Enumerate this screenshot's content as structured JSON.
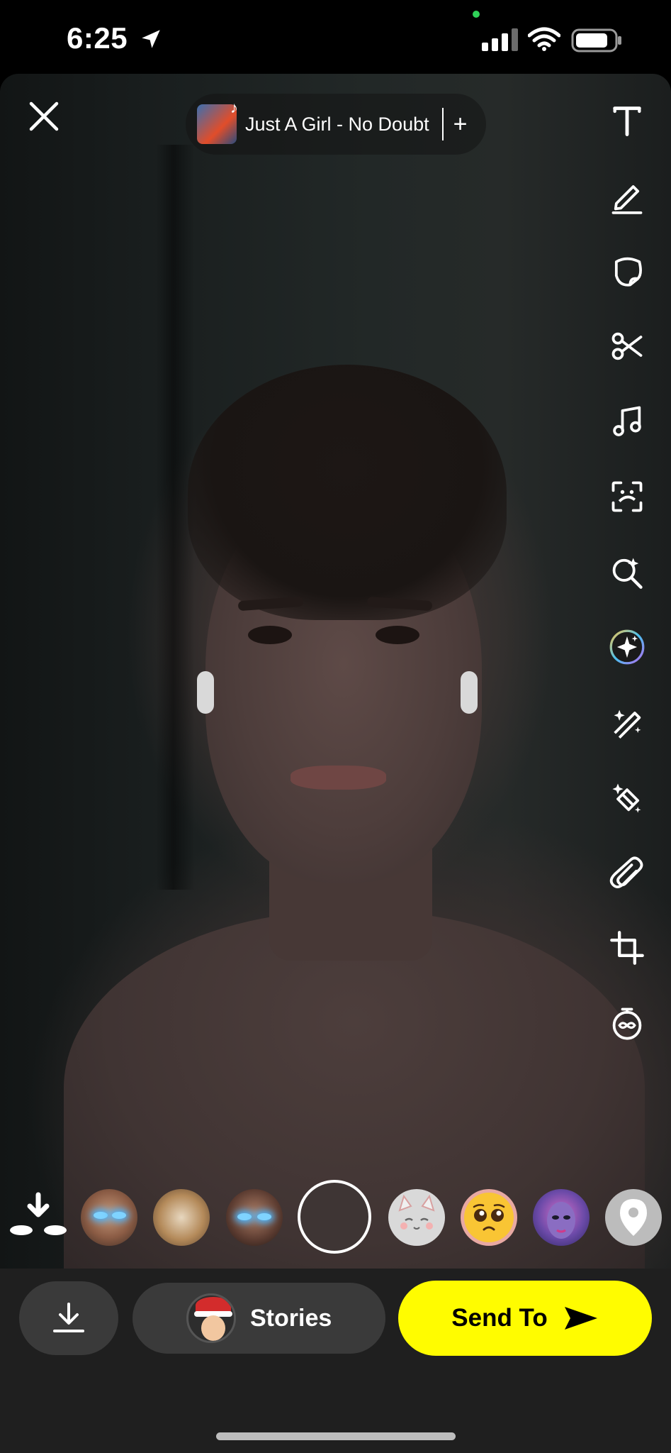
{
  "status_bar": {
    "time": "6:25"
  },
  "top": {
    "song_title": "Just A Girl - No Doubt",
    "add_symbol": "+"
  },
  "toolbar": {
    "icons": [
      "text-icon",
      "pencil-icon",
      "sticker-icon",
      "scissors-icon",
      "music-note-icon",
      "scan-frame-icon",
      "search-sparkle-icon",
      "ai-sparkle-icon",
      "magic-wand-icon",
      "eraser-icon",
      "paperclip-icon",
      "crop-icon",
      "timer-icon"
    ]
  },
  "lenses": [
    "save-lens",
    "glowing-eyes-lens-1",
    "face-morph-lens",
    "glowing-eyes-lens-2",
    "capture",
    "cat-lens",
    "pleading-emoji-lens",
    "mermaid-makeup-lens",
    "location-lens"
  ],
  "bottom_bar": {
    "stories_label": "Stories",
    "send_label": "Send To"
  },
  "colors": {
    "send_yellow": "#fffc00",
    "bar_bg": "#1f1f1f",
    "pill_bg": "#3a3a3a"
  }
}
